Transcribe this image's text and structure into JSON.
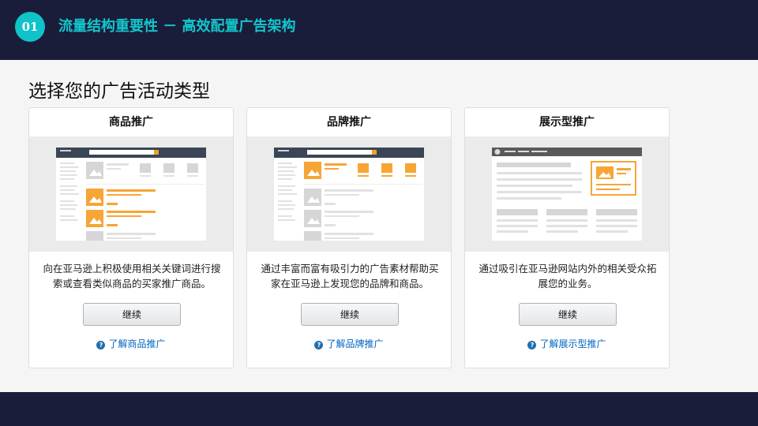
{
  "header": {
    "badge": "01",
    "title": "流量结构重要性 － 高效配置广告架构"
  },
  "main": {
    "heading": "选择您的广告活动类型",
    "cards": [
      {
        "title": "商品推广",
        "description": "向在亚马逊上积极使用相关关键词进行搜索或查看类似商品的买家推广商品。",
        "button": "继续",
        "link": "了解商品推广"
      },
      {
        "title": "品牌推广",
        "description": "通过丰富而富有吸引力的广告素材帮助买家在亚马逊上发现您的品牌和商品。",
        "button": "继续",
        "link": "了解品牌推广"
      },
      {
        "title": "展示型推广",
        "description": "通过吸引在亚马逊网站内外的相关受众拓展您的业务。",
        "button": "继续",
        "link": "了解展示型推广"
      }
    ],
    "help_icon": "question-circle-icon"
  },
  "colors": {
    "dark_bg": "#1a1d3a",
    "teal": "#0fc3c9",
    "orange": "#f7a535",
    "link": "#0066c0"
  }
}
